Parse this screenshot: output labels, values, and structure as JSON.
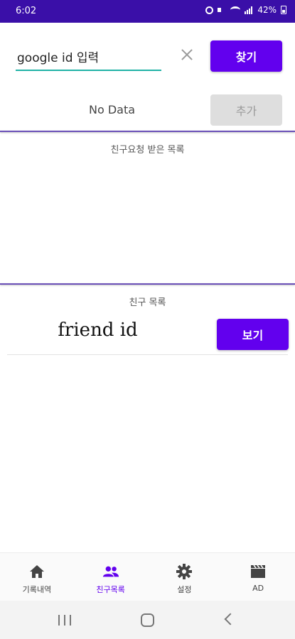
{
  "status_bar": {
    "time": "6:02",
    "battery": "42%"
  },
  "search": {
    "value": "google id 입력",
    "find_label": "찾기"
  },
  "search_result": {
    "text": "No Data",
    "add_label": "추가"
  },
  "received_requests": {
    "title": "친구요청 받은 목록"
  },
  "friends": {
    "title": "친구 목록",
    "items": [
      {
        "id": "friend id",
        "view_label": "보기"
      }
    ]
  },
  "bottom_nav": {
    "items": [
      {
        "label": "기록내역",
        "icon": "home-icon",
        "active": false
      },
      {
        "label": "친구목록",
        "icon": "people-icon",
        "active": true
      },
      {
        "label": "설정",
        "icon": "settings-icon",
        "active": false
      },
      {
        "label": "AD",
        "icon": "clapperboard-icon",
        "active": false
      }
    ]
  },
  "colors": {
    "primary": "#6200ee",
    "status_bar": "#3a0fa8",
    "input_underline": "#20b2a6",
    "active_nav": "#6200ee"
  }
}
